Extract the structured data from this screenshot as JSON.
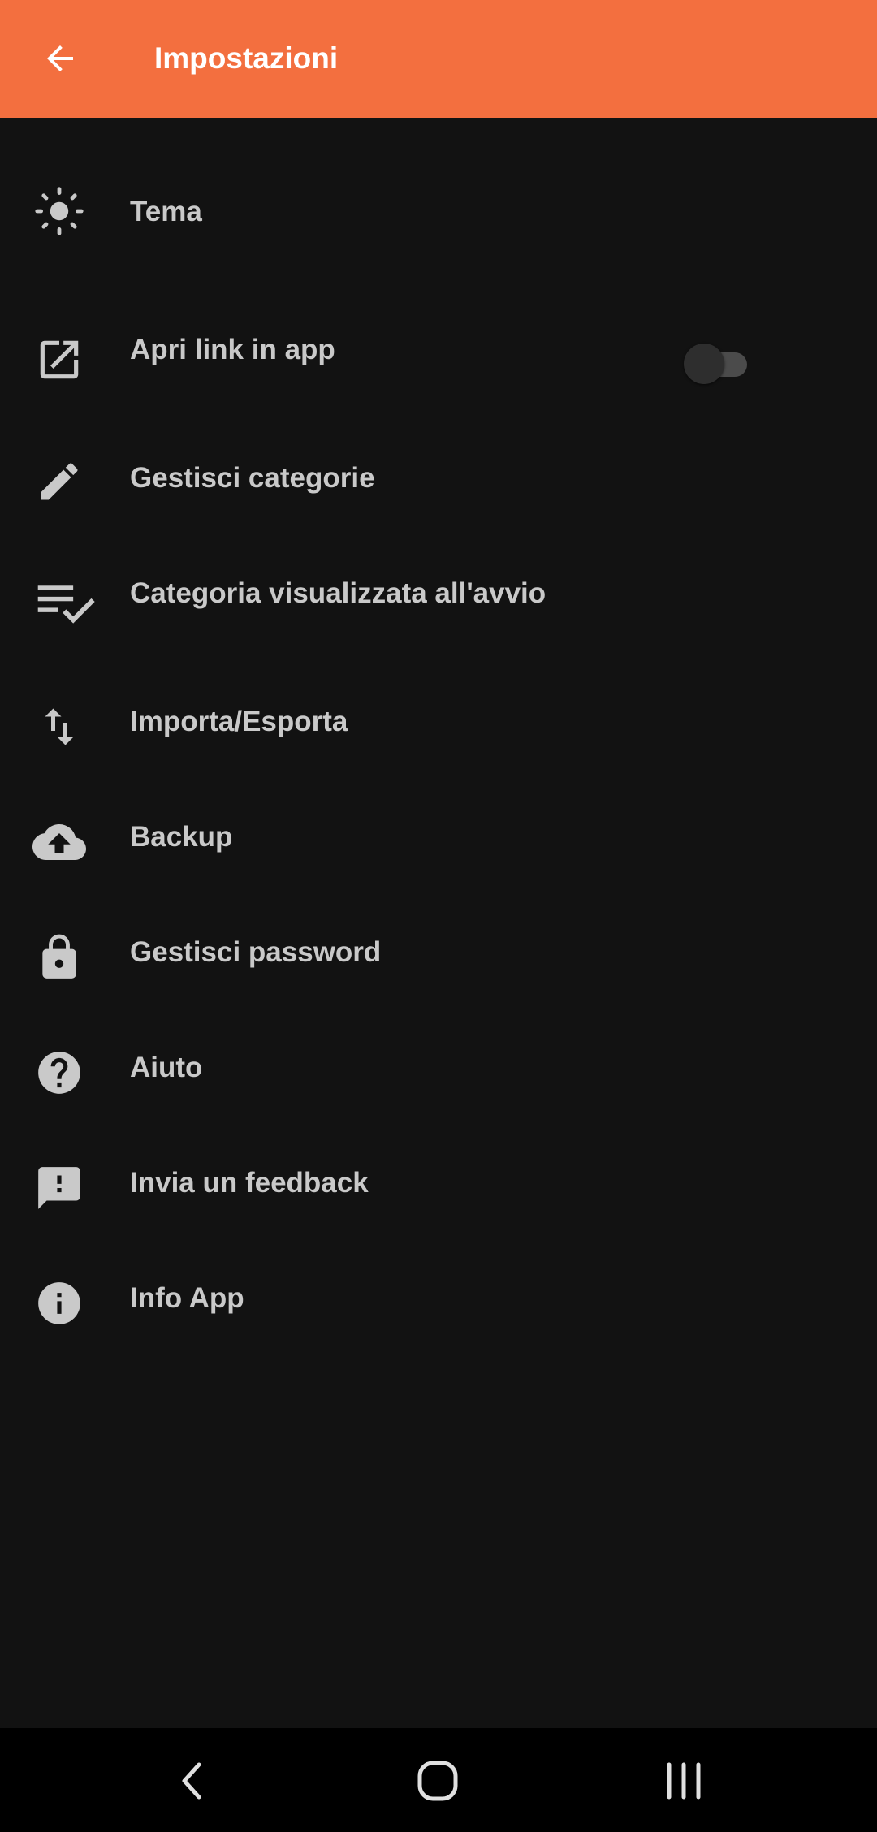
{
  "app_bar": {
    "title": "Impostazioni",
    "back_icon": "arrow-back-icon",
    "color": "#F36F3F"
  },
  "settings": {
    "items": [
      {
        "label": "Tema",
        "icon": "brightness-icon"
      },
      {
        "label": "Apri link in app",
        "icon": "open-in-new-icon",
        "toggle": false
      },
      {
        "label": "Gestisci categorie",
        "icon": "pencil-icon"
      },
      {
        "label": "Categoria visualizzata all'avvio",
        "icon": "playlist-check-icon"
      },
      {
        "label": "Importa/Esporta",
        "icon": "import-export-icon"
      },
      {
        "label": "Backup",
        "icon": "cloud-upload-icon"
      },
      {
        "label": "Gestisci password",
        "icon": "lock-icon"
      },
      {
        "label": "Aiuto",
        "icon": "help-icon"
      },
      {
        "label": "Invia un feedback",
        "icon": "feedback-icon"
      },
      {
        "label": "Info App",
        "icon": "info-icon"
      }
    ]
  },
  "nav_bar": {
    "buttons": [
      "back-nav-icon",
      "home-nav-icon",
      "recents-nav-icon"
    ]
  }
}
